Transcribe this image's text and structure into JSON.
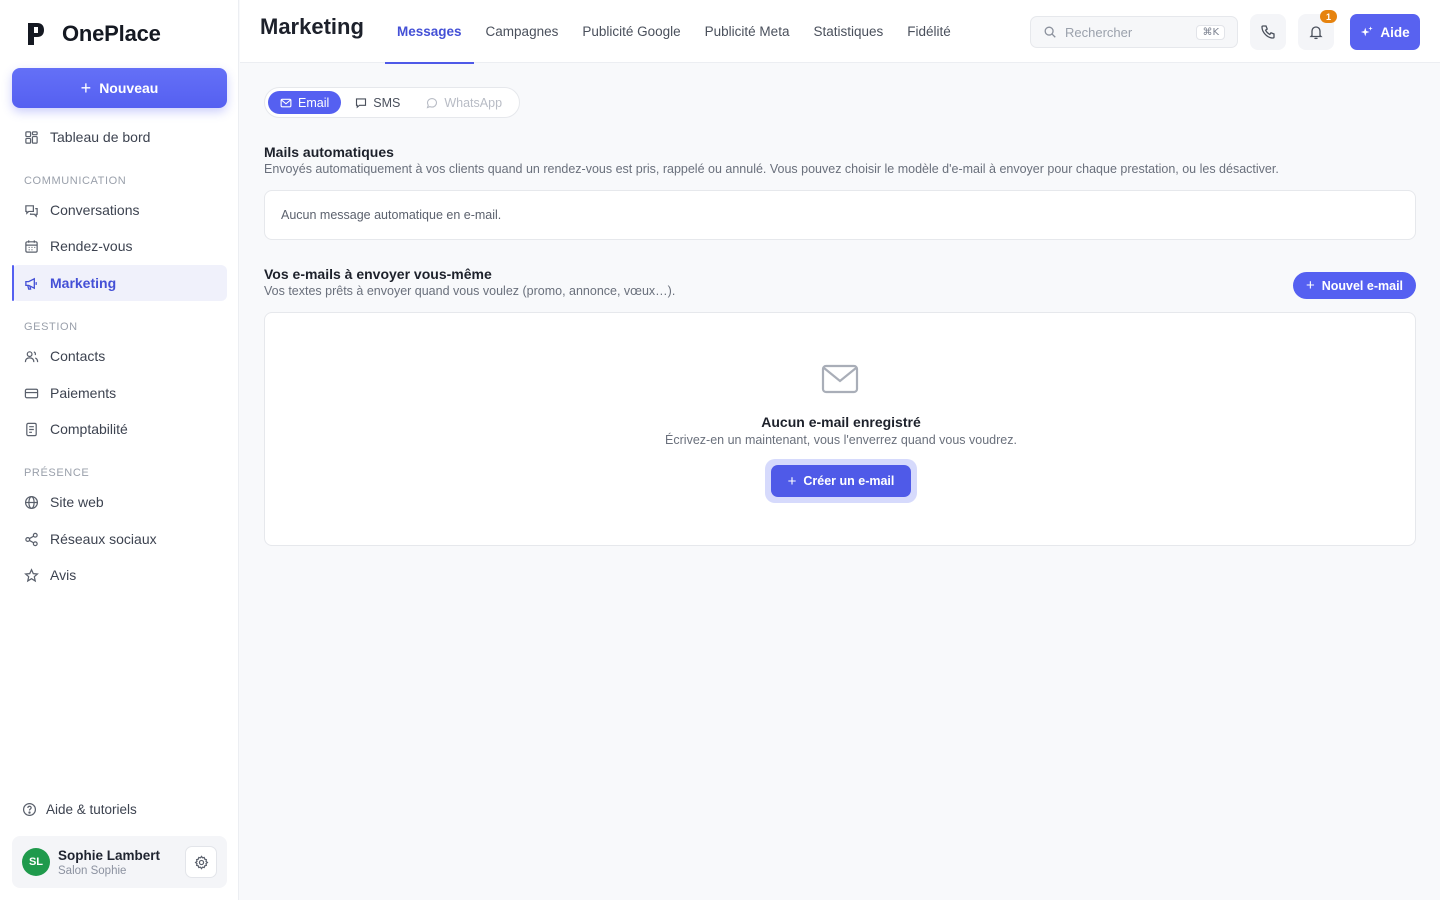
{
  "app": {
    "name": "OnePlace"
  },
  "sidebar": {
    "new_button": "Nouveau",
    "dashboard": "Tableau de bord",
    "sections": [
      {
        "title": "Communication",
        "items": [
          {
            "label": "Conversations",
            "icon": "chat-icon"
          },
          {
            "label": "Rendez-vous",
            "icon": "calendar-icon"
          },
          {
            "label": "Marketing",
            "icon": "megaphone-icon",
            "active": true
          }
        ]
      },
      {
        "title": "Gestion",
        "items": [
          {
            "label": "Contacts",
            "icon": "users-icon"
          },
          {
            "label": "Paiements",
            "icon": "credit-card-icon"
          },
          {
            "label": "Comptabilité",
            "icon": "ledger-icon"
          }
        ]
      },
      {
        "title": "Présence",
        "items": [
          {
            "label": "Site web",
            "icon": "globe-icon"
          },
          {
            "label": "Réseaux sociaux",
            "icon": "share-icon"
          },
          {
            "label": "Avis",
            "icon": "star-icon"
          }
        ]
      }
    ],
    "help": "Aide & tutoriels",
    "user": {
      "initials": "SL",
      "name": "Sophie Lambert",
      "business": "Salon Sophie",
      "avatar_color": "#1f9a4c"
    }
  },
  "header": {
    "title": "Marketing",
    "tabs": [
      {
        "label": "Messages",
        "active": true
      },
      {
        "label": "Campagnes"
      },
      {
        "label": "Publicité Google"
      },
      {
        "label": "Publicité Meta"
      },
      {
        "label": "Statistiques"
      },
      {
        "label": "Fidélité"
      }
    ],
    "search": {
      "placeholder": "Rechercher",
      "shortcut": "⌘K"
    },
    "notification_count": "1",
    "help_button": "Aide"
  },
  "main": {
    "channels": [
      {
        "label": "Email",
        "icon": "mail-icon",
        "state": "active"
      },
      {
        "label": "SMS",
        "icon": "message-icon",
        "state": "normal"
      },
      {
        "label": "WhatsApp",
        "icon": "whatsapp-icon",
        "state": "disabled"
      }
    ],
    "auto": {
      "title": "Mails automatiques",
      "description": "Envoyés automatiquement à vos clients quand un rendez-vous est pris, rappelé ou annulé. Vous pouvez choisir le modèle d'e-mail à envoyer pour chaque prestation, ou les désactiver.",
      "empty": "Aucun message automatique en e-mail."
    },
    "manual": {
      "title": "Vos e-mails à envoyer vous-même",
      "description": "Vos textes prêts à envoyer quand vous voulez (promo, annonce, vœux…).",
      "new_button": "Nouvel e-mail",
      "empty_title": "Aucun e-mail enregistré",
      "empty_desc": "Écrivez-en un maintenant, vous l'enverrez quand vous voudrez.",
      "create_button": "Créer un e-mail"
    }
  },
  "colors": {
    "accent": "#5560f1",
    "badge": "#e6830f"
  }
}
